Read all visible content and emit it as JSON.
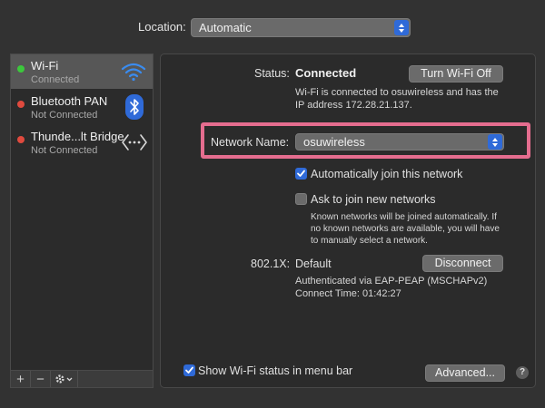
{
  "location": {
    "label": "Location:",
    "value": "Automatic"
  },
  "sidebar": {
    "services": [
      {
        "name": "Wi-Fi",
        "status": "Connected",
        "dot_color": "#3cc83c",
        "icon": "wifi-icon",
        "selected": true
      },
      {
        "name": "Bluetooth PAN",
        "status": "Not Connected",
        "dot_color": "#e04a3e",
        "icon": "bluetooth-icon",
        "selected": false
      },
      {
        "name": "Thunde...lt Bridge",
        "status": "Not Connected",
        "dot_color": "#e04a3e",
        "icon": "thunderbolt-bridge-icon",
        "selected": false
      }
    ],
    "toolbar": {
      "add": "+",
      "remove": "−",
      "actions_icon": "gear-icon"
    }
  },
  "panel": {
    "status_label": "Status:",
    "status_value": "Connected",
    "turn_off_button": "Turn Wi-Fi Off",
    "status_desc_1": "Wi-Fi is connected to osuwireless and has the",
    "status_desc_2": "IP address 172.28.21.137.",
    "network_name_label": "Network Name:",
    "network_name_value": "osuwireless",
    "auto_join_label": "Automatically join this network",
    "auto_join_checked": true,
    "ask_join_label": "Ask to join new networks",
    "ask_join_checked": false,
    "ask_join_desc_1": "Known networks will be joined automatically. If",
    "ask_join_desc_2": "no known networks are available, you will have",
    "ask_join_desc_3": "to manually select a network.",
    "dot1x_label": "802.1X:",
    "dot1x_value": "Default",
    "disconnect_button": "Disconnect",
    "auth_desc": "Authenticated via EAP-PEAP (MSCHAPv2)",
    "connect_time": "Connect Time: 01:42:27",
    "show_status_label": "Show Wi-Fi status in menu bar",
    "show_status_checked": true,
    "advanced_button": "Advanced...",
    "help": "?"
  },
  "colors": {
    "accent": "#2f6ad8",
    "highlight": "#e56d8f",
    "connected": "#3cc83c",
    "disconnected": "#e04a3e"
  }
}
